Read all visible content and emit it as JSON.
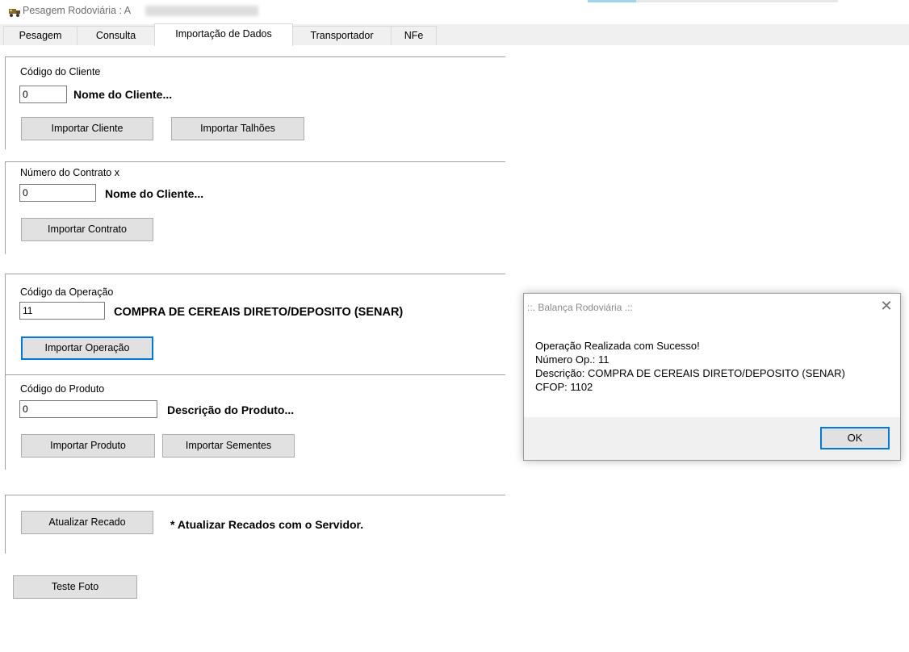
{
  "window": {
    "title": "Pesagem Rodoviária : A",
    "icon": "truck-scale-icon"
  },
  "tabs": [
    {
      "label": "Pesagem",
      "active": false
    },
    {
      "label": "Consulta",
      "active": false
    },
    {
      "label": "Importação de Dados",
      "active": true
    },
    {
      "label": "Transportador",
      "active": false
    },
    {
      "label": "NFe",
      "active": false
    }
  ],
  "cliente": {
    "label": "Código do Cliente",
    "value": "0",
    "name": "Nome do Cliente...",
    "btn_import": "Importar Cliente",
    "btn_talhoes": "Importar Talhões"
  },
  "contrato": {
    "label": "Número do Contrato x",
    "value": "0",
    "name": "Nome do Cliente...",
    "btn_import": "Importar Contrato"
  },
  "operacao": {
    "label": "Código da Operação",
    "value": "11",
    "description": "COMPRA DE CEREAIS DIRETO/DEPOSITO (SENAR)",
    "btn_import": "Importar Operação"
  },
  "produto": {
    "label": "Código do Produto",
    "value": "0",
    "description": "Descrição do Produto...",
    "btn_import": "Importar Produto",
    "btn_sementes": "Importar Sementes"
  },
  "recado": {
    "btn_update": "Atualizar Recado",
    "note": "* Atualizar Recados com o Servidor."
  },
  "teste_foto": "Teste Foto",
  "dialog": {
    "title": "::. Balança Rodoviária .::",
    "close": "✕",
    "lines": [
      "Operação Realizada com Sucesso!",
      "Número Op.: 11",
      "Descrição: COMPRA DE CEREAIS DIRETO/DEPOSITO (SENAR)",
      "CFOP: 1102"
    ],
    "ok": "OK"
  },
  "colors": {
    "focus_accent": "#0078d7",
    "button_face": "#e1e1e1",
    "tab_strip": "#f0f0f0"
  }
}
